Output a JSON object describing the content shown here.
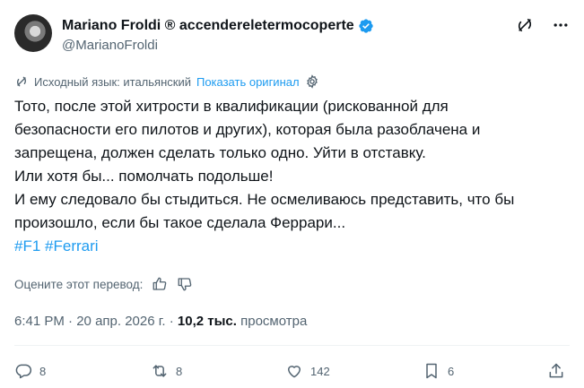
{
  "author": {
    "display_name": "Mariano Froldi ® accendereletermocoperte",
    "handle": "@MarianoFroldi"
  },
  "translation": {
    "source_language_label": "Исходный язык: итальянский",
    "show_original_label": "Показать оригинал"
  },
  "tweet": {
    "lines": [
      "Тото, после этой хитрости в квалификации (рискованной для",
      "безопасности его пилотов и других), которая была разоблачена и",
      "запрещена, должен сделать только одно. Уйти в отставку.",
      "Или хотя бы... помолчать подольше!",
      "И ему следовало бы стыдиться. Не осмеливаюсь представить, что бы",
      "произошло, если бы такое сделала Феррари..."
    ],
    "hashtags": [
      "#F1",
      "#Ferrari"
    ]
  },
  "rate_translation_label": "Оцените этот перевод:",
  "meta": {
    "time": "6:41 PM",
    "separator": "·",
    "date": "20 апр. 2026 г.",
    "views_count": "10,2 тыс.",
    "views_label": "просмотра"
  },
  "actions": {
    "replies": "8",
    "reposts": "8",
    "likes": "142",
    "bookmarks": "6"
  },
  "colors": {
    "accent": "#1d9bf0",
    "secondary_text": "#536471",
    "primary_text": "#0f1419"
  },
  "icons": [
    "verified-badge-icon",
    "grok-icon",
    "more-icon",
    "translate-settings-icon",
    "thumbs-up-icon",
    "thumbs-down-icon",
    "reply-icon",
    "repost-icon",
    "like-icon",
    "bookmark-icon",
    "share-icon"
  ]
}
